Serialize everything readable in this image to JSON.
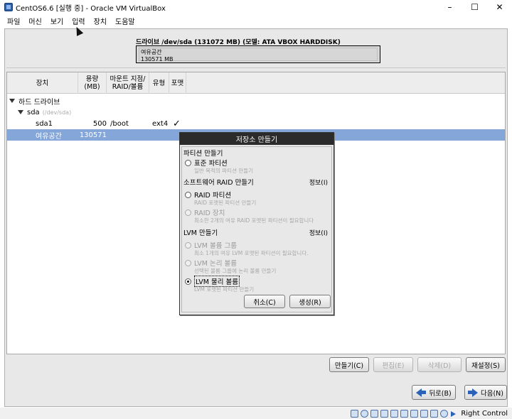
{
  "window": {
    "title": "CentOS6.6 [실행 중] - Oracle VM VirtualBox",
    "controls": [
      "–",
      "☐",
      "✕"
    ]
  },
  "menu": [
    "파일",
    "머신",
    "보기",
    "입력",
    "장치",
    "도움말"
  ],
  "drive": {
    "title": "드라이브 /dev/sda (131072 MB) (모델: ATA VBOX HARDDISK)",
    "free_label": "여유공간",
    "free_size": "130571 MB"
  },
  "table": {
    "headers": {
      "device": "장치",
      "size": "용량\n(MB)",
      "mount": "마운트 지점/\nRAID/볼륨",
      "type": "유형",
      "format": "포맷"
    },
    "group_label": "하드 드라이브",
    "disk_name": "sda",
    "disk_path": "(/dev/sda)",
    "rows": [
      {
        "device": "sda1",
        "size": "500",
        "mount": "/boot",
        "type": "ext4",
        "format": "✓"
      },
      {
        "device": "여유공간",
        "size": "130571",
        "mount": "",
        "type": "",
        "format": ""
      }
    ]
  },
  "dialog": {
    "title": "저장소 만들기",
    "sections": {
      "partition": "파티션 만들기",
      "raid": "소프트웨어 RAID 만들기",
      "lvm": "LVM 만들기"
    },
    "info_label": "정보(I)",
    "options": {
      "standard": {
        "label": "표준 파티션",
        "desc": "일반 목적의 파티션 만들기"
      },
      "raid_part": {
        "label": "RAID 파티션",
        "desc": "RAID 포맷된 파티션 만들기"
      },
      "raid_dev": {
        "label": "RAID 장치",
        "desc": "최소한 2개의 여유 RAID 포맷된 파티션이 필요합니다"
      },
      "lvm_group": {
        "label": "LVM 볼륨 그룹",
        "desc": "최소 1개의 여유 LVM 포맷된 파티션이 필요합니다."
      },
      "lvm_logical": {
        "label": "LVM 논리 볼륨",
        "desc": "선택된 볼륨 그룹에 논리 볼륨 만들기"
      },
      "lvm_physical": {
        "label": "LVM 물리 볼륨",
        "desc": "LVM 포맷된 파티션 만들기"
      }
    },
    "cancel": "취소(C)",
    "create": "생성(R)"
  },
  "buttons": {
    "create": "만들기(C)",
    "edit": "편집(E)",
    "delete": "삭제(D)",
    "reset": "재설정(S)",
    "back": "뒤로(B)",
    "next": "다음(N)"
  },
  "statusbar": {
    "host_key": "Right Control"
  }
}
